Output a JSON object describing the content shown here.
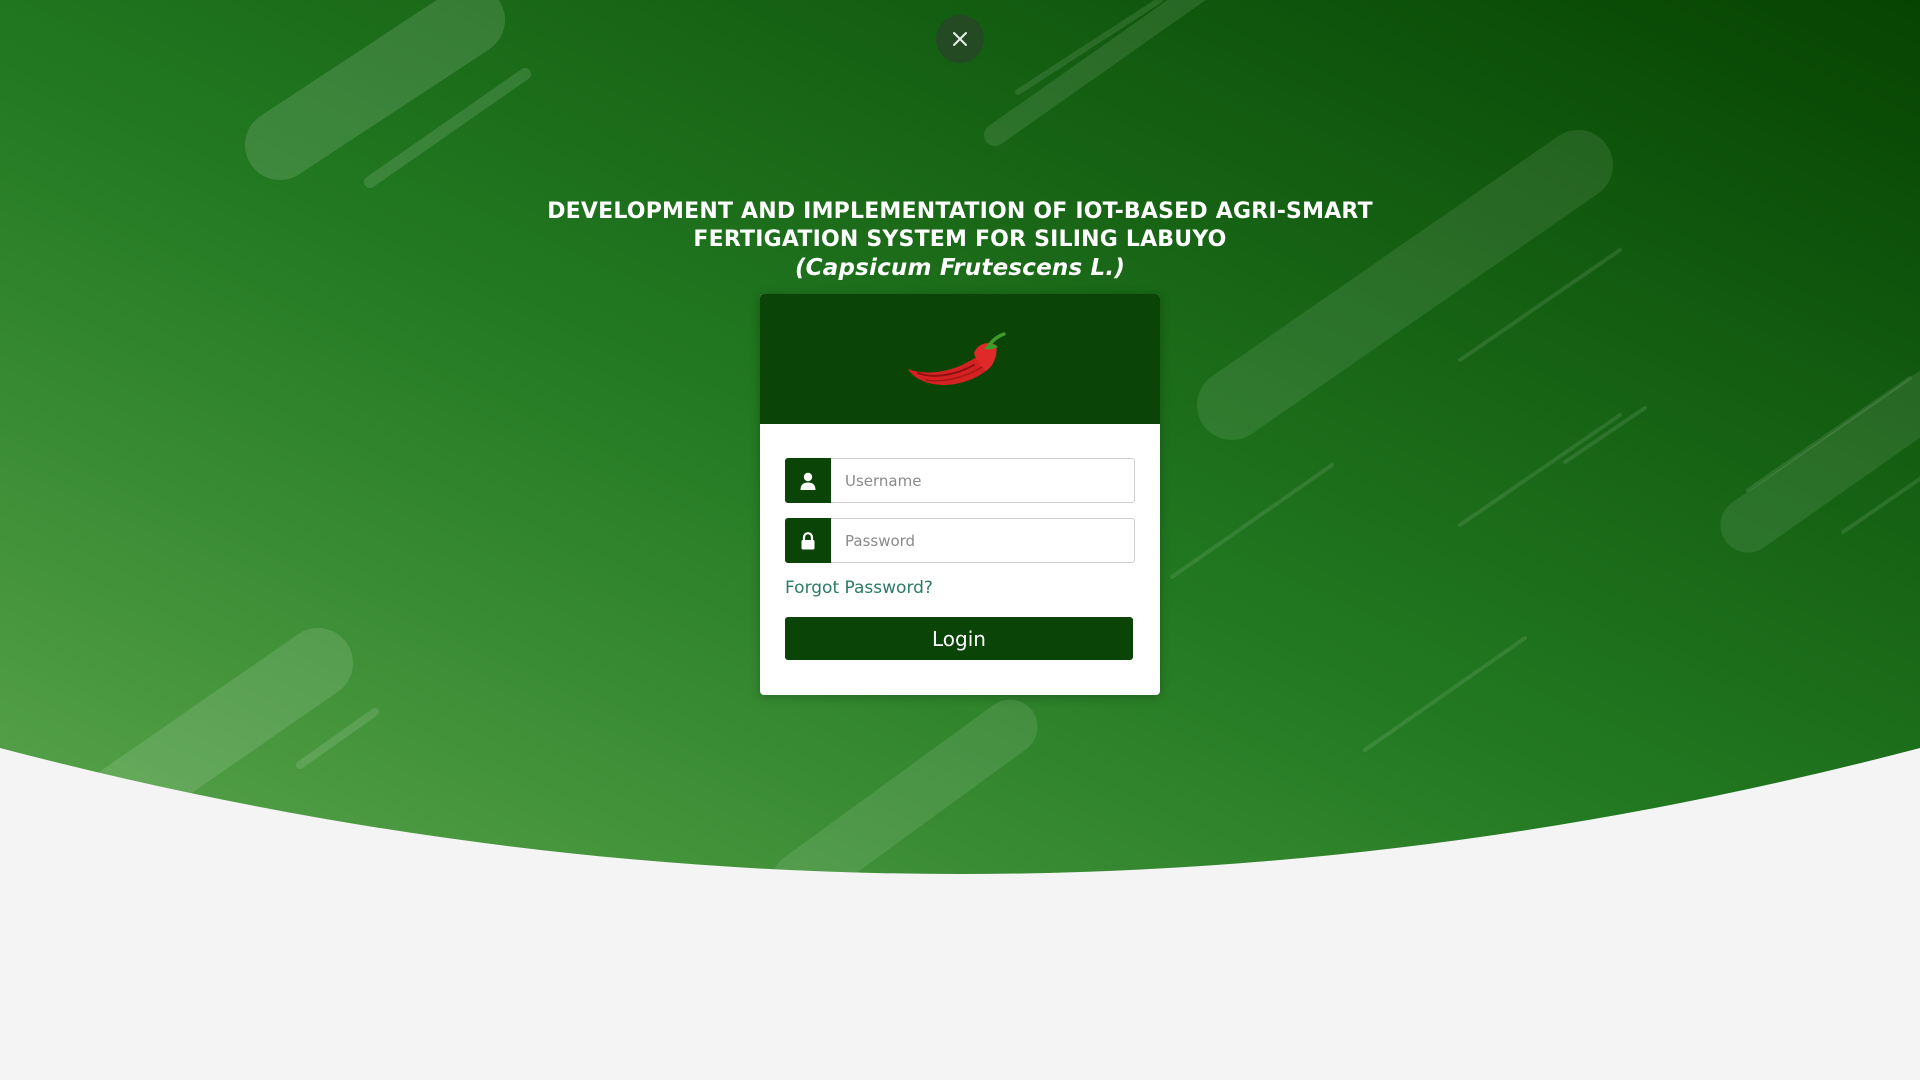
{
  "close_button": {
    "icon": "close-icon"
  },
  "header": {
    "title_line1": "DEVELOPMENT AND IMPLEMENTATION OF IOT-BASED AGRI-SMART",
    "title_line2": "FERTIGATION SYSTEM FOR SILING LABUYO",
    "scientific_name": "(Capsicum Frutescens L.)"
  },
  "login_card": {
    "logo_icon": "chili-pepper-icon",
    "username": {
      "icon": "user-icon",
      "placeholder": "Username",
      "value": ""
    },
    "password": {
      "icon": "lock-icon",
      "placeholder": "Password",
      "value": ""
    },
    "forgot_password_label": "Forgot Password?",
    "login_label": "Login"
  },
  "colors": {
    "brand_green": "#0a4407",
    "hero_light_green": "#4f9c47",
    "link_teal": "#2a7a66",
    "page_bg": "#f4f4f4"
  }
}
